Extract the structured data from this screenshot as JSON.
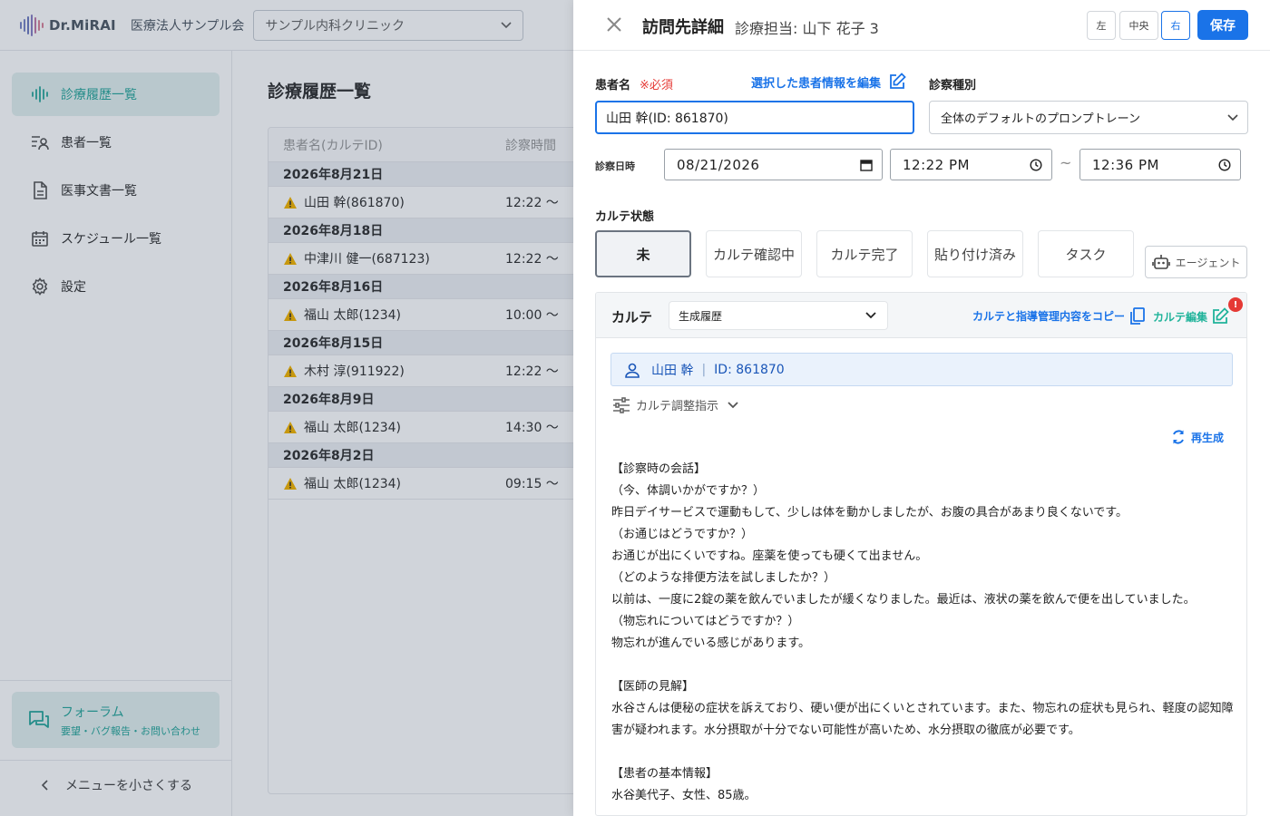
{
  "brand": {
    "name": "Dr.MiRAI",
    "org": "医療法人サンプル会",
    "clinic": "サンプル内科クリニック"
  },
  "sidebar": {
    "items": [
      {
        "label": "診療履歴一覧",
        "icon": "waveform-icon",
        "active": true
      },
      {
        "label": "患者一覧",
        "icon": "patient-list-icon"
      },
      {
        "label": "医事文書一覧",
        "icon": "document-icon"
      },
      {
        "label": "スケジュール一覧",
        "icon": "calendar-icon"
      },
      {
        "label": "設定",
        "icon": "gear-icon"
      }
    ],
    "forum": {
      "title": "フォーラム",
      "subtitle": "要望・バグ報告・お問い合わせ"
    },
    "shrink_label": "メニューを小さくする"
  },
  "main": {
    "title": "診療履歴一覧",
    "columns": [
      "患者名(カルテID)",
      "診察時間"
    ],
    "groups": [
      {
        "date": "2026年8月21日",
        "rows": [
          {
            "name": "山田 幹(861870)",
            "time": "12:22 ～"
          }
        ]
      },
      {
        "date": "2026年8月18日",
        "rows": [
          {
            "name": "中津川 健一(687123)",
            "time": "12:22 ～"
          }
        ]
      },
      {
        "date": "2026年8月16日",
        "rows": [
          {
            "name": "福山 太郎(1234)",
            "time": "10:00 ～"
          }
        ]
      },
      {
        "date": "2026年8月15日",
        "rows": [
          {
            "name": "木村 淳(911922)",
            "time": "12:22 ～"
          }
        ]
      },
      {
        "date": "2026年8月9日",
        "rows": [
          {
            "name": "福山 太郎(1234)",
            "time": "14:30 ～"
          }
        ]
      },
      {
        "date": "2026年8月2日",
        "rows": [
          {
            "name": "福山 太郎(1234)",
            "time": "09:15 ～"
          }
        ]
      }
    ]
  },
  "drawer": {
    "title": "訪問先詳細",
    "doctor": "診療担当: 山下 花子 3",
    "position_buttons": [
      "左",
      "中央",
      "右"
    ],
    "position_selected": "右",
    "save_label": "保存",
    "patient_label": "患者名",
    "required": "※必須",
    "edit_patient_link": "選択した患者情報を編集",
    "patient_value": "山田 幹(ID: 861870)",
    "exam_type_label": "診察種別",
    "exam_type_value": "全体のデフォルトのプロンプトレーン",
    "datetime_label": "診察日時",
    "date_value": "08/21/2026",
    "time_start": "12:22 PM",
    "time_sep": "~",
    "time_end": "12:36 PM",
    "status_label": "カルテ状態",
    "status_options": [
      "未",
      "カルテ確認中",
      "カルテ完了",
      "貼り付け済み",
      "タスク"
    ],
    "status_selected": "未",
    "agent_label": "エージェント",
    "karte": {
      "label": "カルテ",
      "history_select": "生成履歴",
      "copy_label": "カルテと指導管理内容をコピー",
      "edit_label": "カルテ編集",
      "badge": "!",
      "patient_name": "山田 幹",
      "patient_id": "ID: 861870",
      "adjust_label": "カルテ調整指示",
      "regen_label": "再生成",
      "text": "【診察時の会話】\n（今、体調いかがですか？）\n昨日デイサービスで運動もして、少しは体を動かしましたが、お腹の具合があまり良くないです。\n（お通じはどうですか？）\nお通じが出にくいですね。座薬を使っても硬くて出ません。\n（どのような排便方法を試しましたか？）\n以前は、一度に2錠の薬を飲んでいましたが緩くなりました。最近は、液状の薬を飲んで便を出していました。\n（物忘れについてはどうですか？）\n物忘れが進んでいる感じがあります。\n\n【医師の見解】\n水谷さんは便秘の症状を訴えており、硬い便が出にくいとされています。また、物忘れの症状も見られ、軽度の認知障害が疑われます。水分摂取が十分でない可能性が高いため、水分摂取の徹底が必要です。\n\n【患者の基本情報】\n水谷美代子、女性、85歳。"
    }
  }
}
